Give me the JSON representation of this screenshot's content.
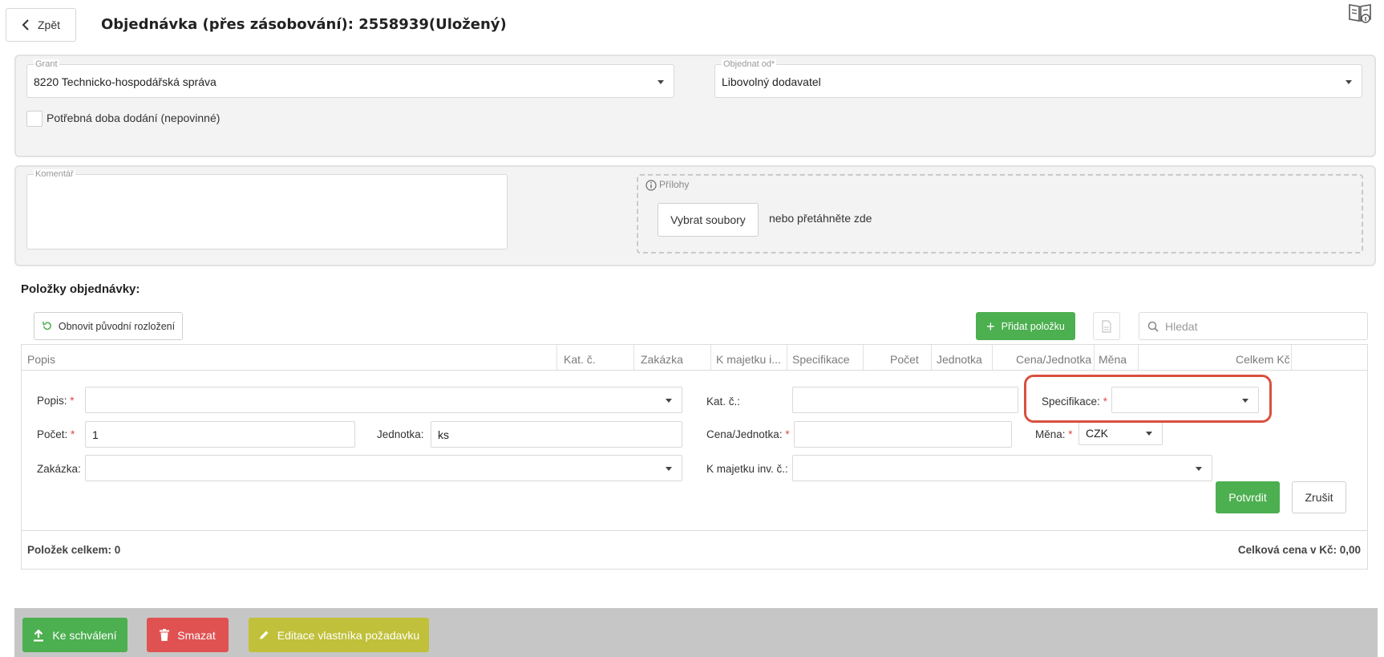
{
  "header": {
    "back_label": "Zpět",
    "title": "Objednávka (přes zásobování): 2558939(Uložený)"
  },
  "order_panel": {
    "grant_legend": "Grant",
    "grant_value": "8220 Technicko-hospodářská správa",
    "supplier_legend": "Objednat od*",
    "supplier_value": "Libovolný dodavatel",
    "delivery_label": "Potřebná doba dodání (nepovinné)"
  },
  "comment_panel": {
    "comment_legend": "Komentář",
    "attachments_legend": "Přílohy",
    "select_files_label": "Vybrat soubory",
    "drag_hint": "nebo přetáhněte zde"
  },
  "items": {
    "section_title": "Položky objednávky:",
    "reset_layout_label": "Obnovit původní rozložení",
    "add_item_label": "Přidat položku",
    "search_placeholder": "Hledat",
    "columns": [
      "Popis",
      "Kat. č.",
      "Zakázka",
      "K majetku i...",
      "Specifikace",
      "Počet",
      "Jednotka",
      "Cena/Jednotka",
      "Měna",
      "Celkem Kč"
    ],
    "form": {
      "popis_label": "Popis:",
      "pocet_label": "Počet:",
      "pocet_value": "1",
      "jednotka_label": "Jednotka:",
      "jednotka_value": "ks",
      "zakazka_label": "Zakázka:",
      "kat_label": "Kat. č.:",
      "cena_label": "Cena/Jednotka:",
      "majetek_label": "K majetku inv. č.:",
      "specifikace_label": "Specifikace:",
      "mena_label": "Měna:",
      "mena_value": "CZK",
      "required_mark": "*",
      "confirm_label": "Potvrdit",
      "cancel_label": "Zrušit"
    },
    "total_items": "Položek celkem: 0",
    "total_price": "Celková cena v Kč: 0,00"
  },
  "footer": {
    "submit_label": "Ke schválení",
    "delete_label": "Smazat",
    "edit_owner_label": "Editace vlastníka požadavku"
  },
  "colors": {
    "green": "#4caf50",
    "red": "#e05252",
    "olive": "#c0c03a",
    "highlight": "#d9503f"
  }
}
